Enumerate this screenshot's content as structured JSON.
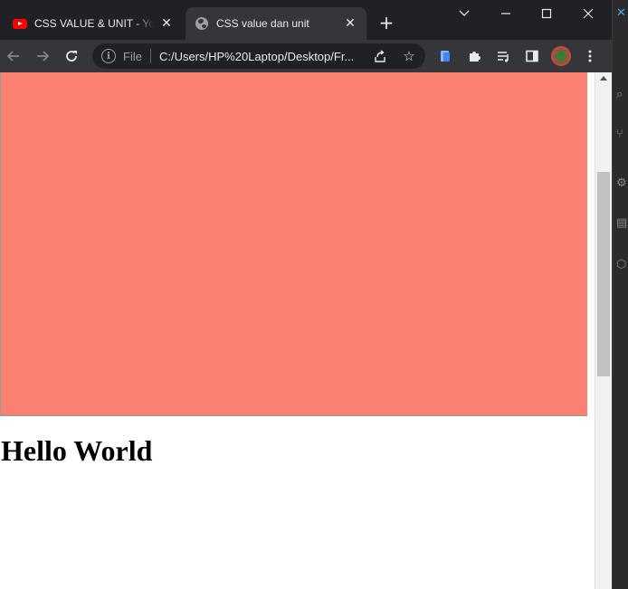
{
  "tabs": [
    {
      "title": "CSS VALUE & UNIT - YouTube",
      "favicon": "youtube-icon",
      "active": false
    },
    {
      "title": "CSS value dan unit",
      "favicon": "globe-icon",
      "active": true
    }
  ],
  "omnibox": {
    "scheme": "File",
    "url": "C:/Users/HP%20Laptop/Desktop/Fr..."
  },
  "page": {
    "heading": "Hello World",
    "box_color": "#fa8072"
  },
  "colors": {
    "frame": "#202124",
    "toolbar": "#35363a",
    "text": "#e8eaed"
  }
}
